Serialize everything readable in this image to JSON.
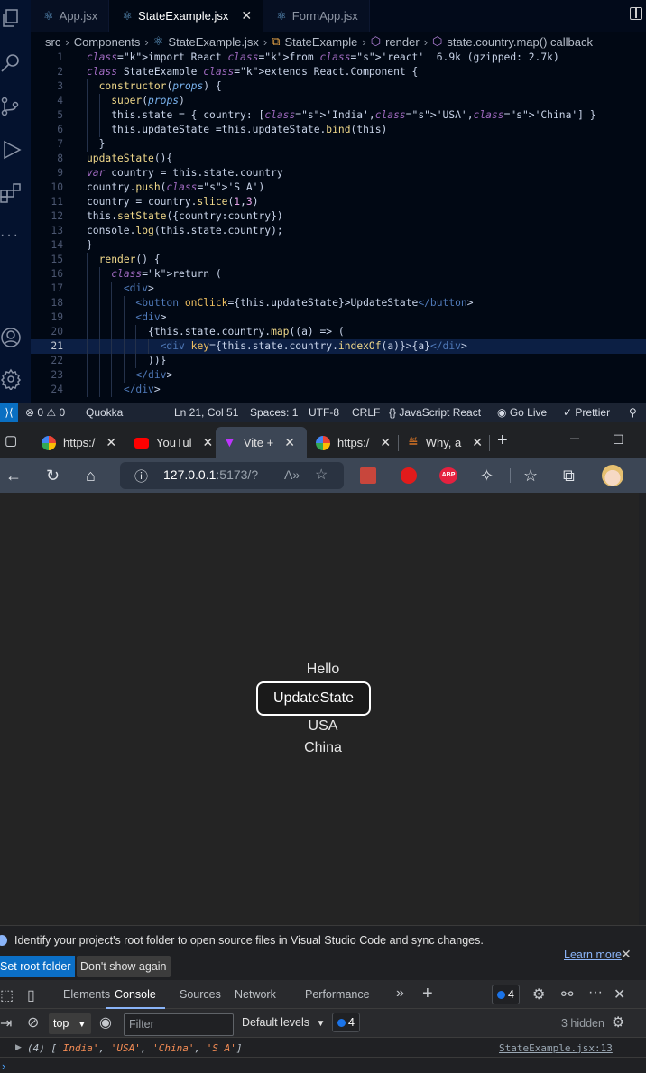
{
  "vscode": {
    "tabs": [
      {
        "label": "App.jsx",
        "active": false
      },
      {
        "label": "StateExample.jsx",
        "active": true
      },
      {
        "label": "FormApp.jsx",
        "active": false
      }
    ],
    "breadcrumb": [
      "src",
      "Components",
      "StateExample.jsx",
      "StateExample",
      "render",
      "state.country.map() callback"
    ],
    "code_lines": [
      {
        "n": "1",
        "text": "import React from 'react'  6.9k (gzipped: 2.7k)"
      },
      {
        "n": "2",
        "text": "class StateExample extends React.Component {"
      },
      {
        "n": "3",
        "text": "  constructor(props) {"
      },
      {
        "n": "4",
        "text": "    super(props)"
      },
      {
        "n": "5",
        "text": "    this.state = { country: ['India','USA','China'] }"
      },
      {
        "n": "6",
        "text": "    this.updateState =this.updateState.bind(this)"
      },
      {
        "n": "7",
        "text": "  }"
      },
      {
        "n": "8",
        "text": "updateState(){"
      },
      {
        "n": "9",
        "text": "var country = this.state.country"
      },
      {
        "n": "10",
        "text": "country.push('S A')"
      },
      {
        "n": "11",
        "text": "country = country.slice(1,3)"
      },
      {
        "n": "12",
        "text": "this.setState({country:country})"
      },
      {
        "n": "13",
        "text": "console.log(this.state.country);"
      },
      {
        "n": "14",
        "text": "}"
      },
      {
        "n": "15",
        "text": "  render() {"
      },
      {
        "n": "16",
        "text": "    return ("
      },
      {
        "n": "17",
        "text": "      <div>"
      },
      {
        "n": "18",
        "text": "        <button onClick={this.updateState}>UpdateState</button>"
      },
      {
        "n": "19",
        "text": "        <div>"
      },
      {
        "n": "20",
        "text": "          {this.state.country.map((a) => ("
      },
      {
        "n": "21",
        "text": "            <div key={this.state.country.indexOf(a)}>{a}</div>"
      },
      {
        "n": "22",
        "text": "          ))}"
      },
      {
        "n": "23",
        "text": "        </div>"
      },
      {
        "n": "24",
        "text": "      </div>"
      }
    ],
    "current_line": "21",
    "status": {
      "errors": "0",
      "warnings": "0",
      "quokka": "Quokka",
      "position": "Ln 21, Col 51",
      "spaces": "Spaces: 1",
      "encoding": "UTF-8",
      "eol": "CRLF",
      "language": "JavaScript React",
      "golive": "Go Live",
      "prettier": "Prettier"
    }
  },
  "browser": {
    "tabs": [
      {
        "label": "https:/",
        "favicon": "google-icon"
      },
      {
        "label": "YouTul",
        "favicon": "youtube-icon"
      },
      {
        "label": "Vite +",
        "favicon": "vite-icon",
        "active": true
      },
      {
        "label": "https:/",
        "favicon": "google-icon"
      },
      {
        "label": "Why, a",
        "favicon": "stackoverflow-icon"
      }
    ],
    "url_host": "127.0.0.1",
    "url_rest": ":5173/?"
  },
  "page": {
    "hello": "Hello",
    "button": "UpdateState",
    "countries": [
      "USA",
      "China"
    ]
  },
  "devtools": {
    "info_text": "Identify your project's root folder to open source files in Visual Studio Code and sync changes.",
    "set_root": "Set root folder",
    "dont_show": "Don't show again",
    "learn_more": "Learn more",
    "tabs": [
      "Elements",
      "Console",
      "Sources",
      "Network",
      "Performance"
    ],
    "active_tab": "Console",
    "issues_count": "4",
    "context": "top",
    "filter_placeholder": "Filter",
    "levels": "Default levels",
    "messages_count": "4",
    "hidden": "3 hidden",
    "log": {
      "prefix": "(4) [",
      "items": [
        "'India'",
        "'USA'",
        "'China'",
        "'S A'"
      ],
      "source": "StateExample.jsx:13"
    }
  }
}
